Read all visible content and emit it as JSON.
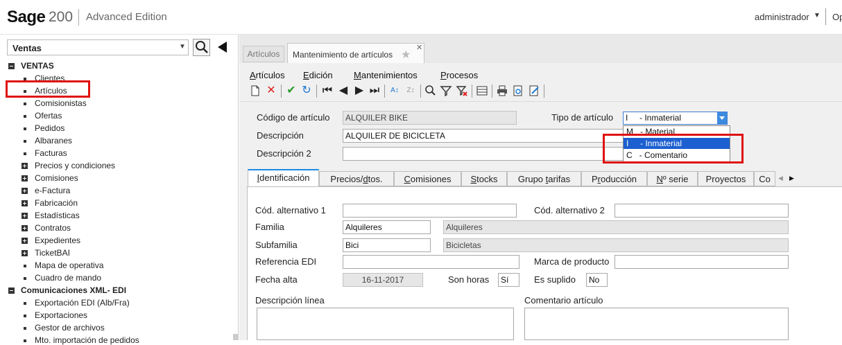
{
  "app": {
    "logo": "Sage",
    "product": "200",
    "edition": "Advanced Edition",
    "user": "administrador",
    "options_truncated": "Op"
  },
  "sidebar": {
    "module": "Ventas",
    "tree": [
      {
        "label": "VENTAS",
        "kind": "group-open"
      },
      {
        "label": "Clientes",
        "kind": "leaf"
      },
      {
        "label": "Artículos",
        "kind": "leaf",
        "highlighted": true
      },
      {
        "label": "Comisionistas",
        "kind": "leaf"
      },
      {
        "label": "Ofertas",
        "kind": "leaf"
      },
      {
        "label": "Pedidos",
        "kind": "leaf"
      },
      {
        "label": "Albaranes",
        "kind": "leaf"
      },
      {
        "label": "Facturas",
        "kind": "leaf"
      },
      {
        "label": "Precios y condiciones",
        "kind": "folder"
      },
      {
        "label": "Comisiones",
        "kind": "folder"
      },
      {
        "label": "e-Factura",
        "kind": "folder"
      },
      {
        "label": "Fabricación",
        "kind": "folder"
      },
      {
        "label": "Estadísticas",
        "kind": "folder"
      },
      {
        "label": "Contratos",
        "kind": "folder"
      },
      {
        "label": "Expedientes",
        "kind": "folder"
      },
      {
        "label": "TicketBAI",
        "kind": "folder"
      },
      {
        "label": "Mapa de operativa",
        "kind": "leaf"
      },
      {
        "label": "Cuadro de mando",
        "kind": "leaf"
      },
      {
        "label": "Comunicaciones XML- EDI",
        "kind": "group-open"
      },
      {
        "label": "Exportación EDI (Alb/Fra)",
        "kind": "leaf"
      },
      {
        "label": "Exportaciones",
        "kind": "leaf"
      },
      {
        "label": "Gestor de archivos",
        "kind": "leaf"
      },
      {
        "label": "Mto. importación de pedidos",
        "kind": "leaf"
      }
    ]
  },
  "tabs": {
    "inactive": "Artículos",
    "active": "Mantenimiento de artículos"
  },
  "menu": [
    {
      "pre": "",
      "ul": "A",
      "post": "rtículos"
    },
    {
      "pre": "",
      "ul": "E",
      "post": "dición"
    },
    {
      "pre": "",
      "ul": "M",
      "post": "antenimientos"
    },
    {
      "pre": "",
      "ul": "P",
      "post": "rocesos"
    }
  ],
  "header_form": {
    "codigo_label": "Código de artículo",
    "codigo_value": "ALQUILER BIKE",
    "descripcion_label": "Descripción",
    "descripcion_value": "ALQUILER DE BICICLETA",
    "descripcion2_label": "Descripción 2",
    "descripcion2_value": "",
    "tipo_label": "Tipo de artículo",
    "tipo_value": "I     - Inmaterial",
    "tipo_options": [
      "M   - Material",
      "I     - Inmaterial",
      "C   - Comentario"
    ],
    "tipo_selected_index": 1
  },
  "inner_tabs": [
    {
      "pre": "",
      "ul": "I",
      "post": "dentificación"
    },
    {
      "pre": "Precios/",
      "ul": "d",
      "post": "tos."
    },
    {
      "pre": "",
      "ul": "C",
      "post": "omisiones"
    },
    {
      "pre": "",
      "ul": "S",
      "post": "tocks"
    },
    {
      "pre": "Grupo ",
      "ul": "t",
      "post": "arifas"
    },
    {
      "pre": "P",
      "ul": "r",
      "post": "oducción"
    },
    {
      "pre": "",
      "ul": "N",
      "post": "º serie"
    },
    {
      "pre": "Proyectos",
      "ul": "",
      "post": ""
    },
    {
      "pre": "Co",
      "ul": "",
      "post": ""
    }
  ],
  "identificacion": {
    "cod_alt1_label": "Cód. alternativo 1",
    "cod_alt1_value": "",
    "cod_alt2_label": "Cód. alternativo 2",
    "cod_alt2_value": "",
    "familia_label": "Familia",
    "familia_code": "Alquileres",
    "familia_name": "Alquileres",
    "subfamilia_label": "Subfamilia",
    "subfamilia_code": "Bici",
    "subfamilia_name": "Bicicletas",
    "ref_edi_label": "Referencia EDI",
    "ref_edi_value": "",
    "marca_label": "Marca de producto",
    "marca_value": "",
    "fecha_alta_label": "Fecha alta",
    "fecha_alta_value": "16-11-2017",
    "son_horas_label": "Son horas",
    "son_horas_value": "Sí",
    "es_suplido_label": "Es suplido",
    "es_suplido_value": "No",
    "desc_linea_label": "Descripción línea",
    "comentario_label": "Comentario artículo"
  },
  "colors": {
    "highlight_box": "#e01010",
    "selected_option": "#1c5fd0",
    "active_tab_accent": "#1e88e5"
  }
}
